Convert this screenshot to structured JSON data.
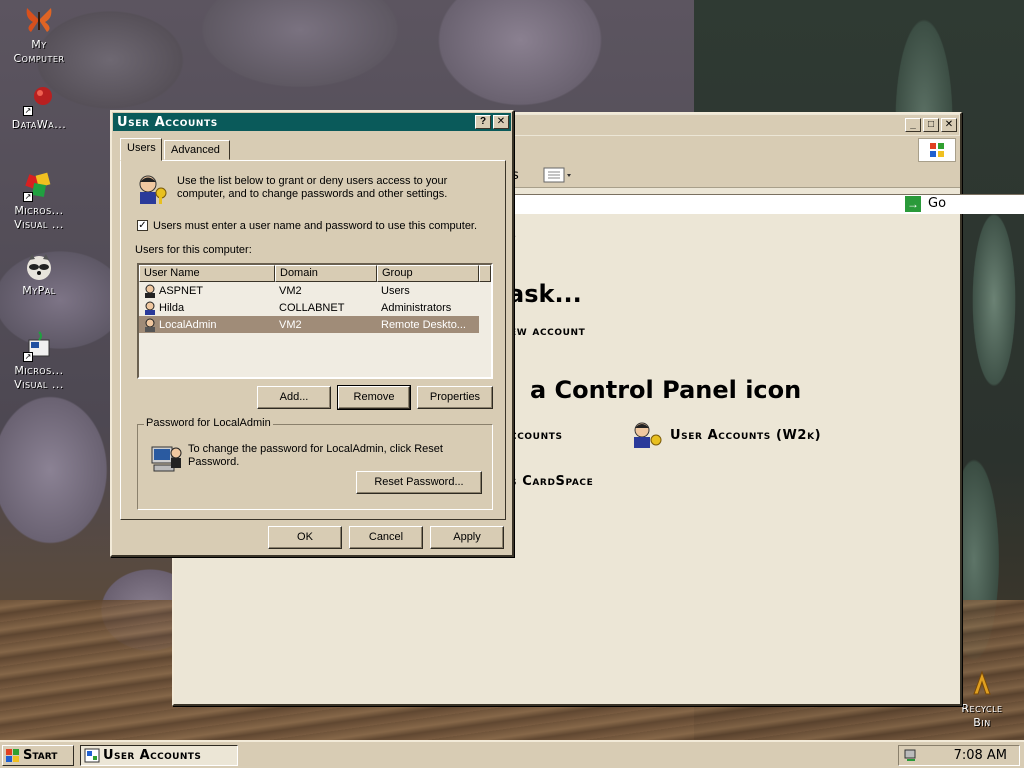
{
  "desktop": {
    "icons": [
      {
        "label": "My\nComputer"
      },
      {
        "label": "DataWa..."
      },
      {
        "label": "Micros...\nVisual ..."
      },
      {
        "label": "MyPal"
      },
      {
        "label": "Micros...\nVisual ..."
      },
      {
        "label": "Recycle\nBin"
      }
    ]
  },
  "control_panel": {
    "go_label": "Go",
    "toolbar_frag": "s",
    "heading1": "ask...",
    "link_new_account": "ew account",
    "heading2": "a Control Panel icon",
    "link_accounts": "ccounts",
    "link_user_accounts_w2k": "User Accounts (W2k)",
    "link_cardspace": "s CardSpace",
    "frag_s": "s"
  },
  "dialog": {
    "title": "User Accounts",
    "tabs": [
      "Users",
      "Advanced"
    ],
    "intro": "Use the list below to grant or deny users access to your computer, and to change passwords and other settings.",
    "checkbox_label": "Users must enter a user name and password to use this computer.",
    "checkbox_checked": "✓",
    "users_label": "Users for this computer:",
    "columns": [
      "User Name",
      "Domain",
      "Group"
    ],
    "rows": [
      {
        "name": "ASPNET",
        "domain": "VM2",
        "group": "Users"
      },
      {
        "name": "Hilda",
        "domain": "COLLABNET",
        "group": "Administrators"
      },
      {
        "name": "LocalAdmin",
        "domain": "VM2",
        "group": "Remote Deskto..."
      }
    ],
    "buttons": {
      "add": "Add...",
      "remove": "Remove",
      "properties": "Properties"
    },
    "password_group": "Password for LocalAdmin",
    "password_text": "To change the password for LocalAdmin, click Reset Password.",
    "reset_password": "Reset Password...",
    "footer": {
      "ok": "OK",
      "cancel": "Cancel",
      "apply": "Apply"
    }
  },
  "taskbar": {
    "start": "Start",
    "task": "User Accounts",
    "clock": "7:08 AM"
  },
  "colors": {
    "titlebar": "#0a5a5a",
    "selection": "#a08c78",
    "face": "#d8ccb4"
  }
}
